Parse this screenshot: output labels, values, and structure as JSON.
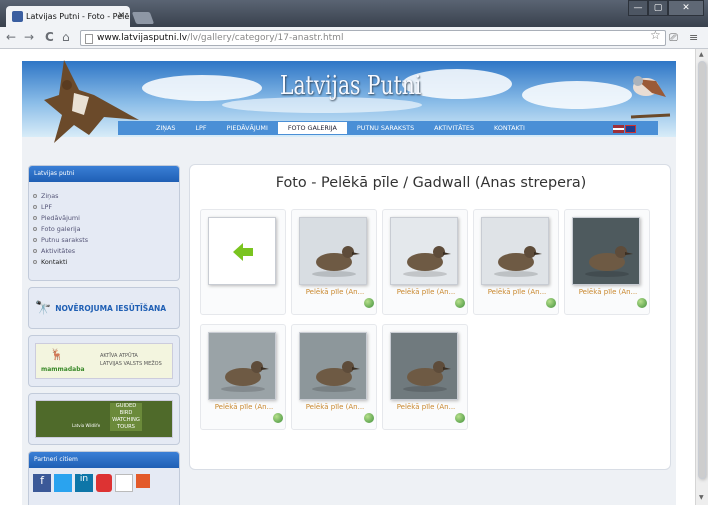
{
  "browser": {
    "tab_title": "Latvijas Putni - Foto - Pelēkā",
    "tab_close": "✕",
    "url_domain": "www.latvijasputni.lv",
    "url_path": "/lv/gallery/category/17-anastr.html",
    "win_min": "—",
    "win_max": "▢",
    "win_close": "✕",
    "back": "←",
    "forward": "→",
    "reload": "C",
    "home": "⌂",
    "bookmark": "☆",
    "menu_icon": "≡",
    "screen_icon": "⎚"
  },
  "site": {
    "title": "Latvijas Putni",
    "menu": [
      "ZIŅAS",
      "LPF",
      "PIEDĀVĀJUMI",
      "FOTO GALERIJA",
      "PUTNU SARAKSTS",
      "AKTIVITĀTES",
      "KONTAKTI"
    ],
    "active_menu": "FOTO GALERIJA"
  },
  "sidebar": {
    "box1_title": "Latvijas putni",
    "items": [
      "Ziņas",
      "LPF",
      "Piedāvājumi",
      "Foto galerija",
      "Putnu saraksts",
      "Aktivitātes",
      "Kontakti"
    ],
    "ad1_text": "NOVĒROJUMA IESŪTĪŠANA",
    "ad2_logo": "mammadaba",
    "ad2_text1": "AKTĪVA ATPŪTA",
    "ad2_text2": "LATVIJAS VALSTS MEŽOS",
    "ad3_text1": "GUIDED",
    "ad3_text2": "BIRD",
    "ad3_text3": "WATCHING",
    "ad3_text4": "TOURS",
    "ad3_brand": "Latvia Wildlife",
    "box2_title": "Partneri citiem"
  },
  "gallery": {
    "title": "Foto - Pelēkā pīle / Gadwall (Anas strepera)",
    "caption": "Pelēkā pīle (An...",
    "back_icon": "green-left-arrow"
  },
  "colors": {
    "accent": "#1f5fb4",
    "caption": "#c9882e",
    "back_arrow": "#7ac41f"
  }
}
